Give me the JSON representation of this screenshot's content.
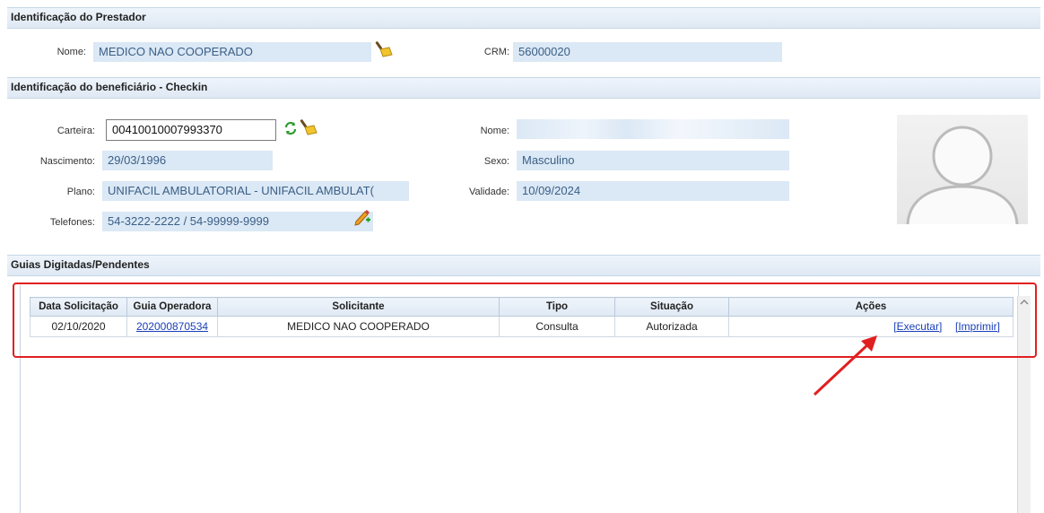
{
  "prestador": {
    "section_title": "Identificação do Prestador",
    "nome_label": "Nome:",
    "nome_value": "MEDICO NAO COOPERADO",
    "crm_label": "CRM:",
    "crm_value": "56000020"
  },
  "beneficiario": {
    "section_title": "Identificação do beneficiário - Checkin",
    "carteira_label": "Carteira:",
    "carteira_value": "00410010007993370",
    "nascimento_label": "Nascimento:",
    "nascimento_value": "29/03/1996",
    "plano_label": "Plano:",
    "plano_value": "UNIFACIL AMBULATORIAL - UNIFACIL AMBULAT(",
    "telefones_label": "Telefones:",
    "telefones_value": "54-3222-2222 / 54-99999-9999",
    "nome_label": "Nome:",
    "nome_value": "",
    "sexo_label": "Sexo:",
    "sexo_value": "Masculino",
    "validade_label": "Validade:",
    "validade_value": "10/09/2024"
  },
  "guias": {
    "section_title": "Guias Digitadas/Pendentes",
    "columns": [
      "Data Solicitação",
      "Guia Operadora",
      "Solicitante",
      "Tipo",
      "Situação",
      "Ações"
    ],
    "rows": [
      {
        "data": "02/10/2020",
        "guia": "202000870534",
        "solicitante": "MEDICO NAO COOPERADO",
        "tipo": "Consulta",
        "situacao": "Autorizada",
        "executar": "[Executar]",
        "imprimir": "[Imprimir]"
      }
    ]
  },
  "colors": {
    "highlight_box": "#e02020",
    "field_bg": "#dbe8f5",
    "field_text": "#3a5f86",
    "link": "#1a3fb8"
  },
  "icons": {
    "broom": "broom-icon",
    "refresh": "refresh-icon",
    "edit_phone": "edit-add-icon",
    "avatar": "user-placeholder-icon",
    "scroll_up": "scroll-up-arrow-icon"
  }
}
